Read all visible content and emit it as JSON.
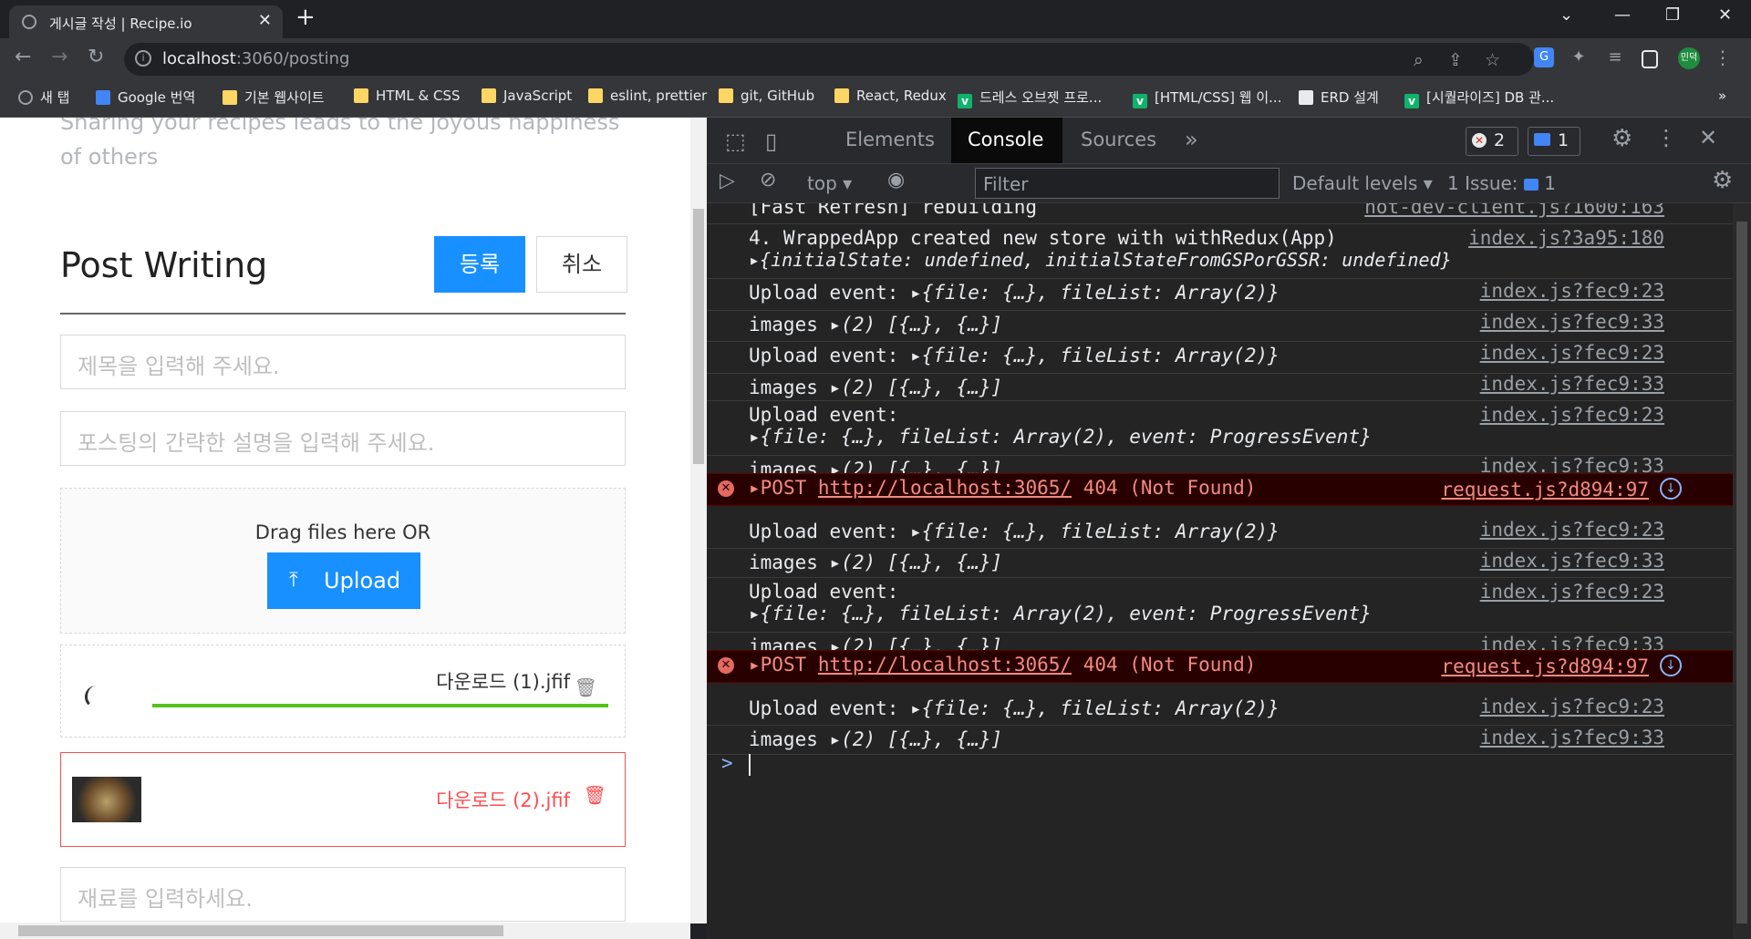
{
  "browser": {
    "tab_title": "게시글 작성 | Recipe.io",
    "new_tab_label": "+",
    "url_host": "localhost",
    "url_path": ":3060/posting",
    "profile_label": "민덕"
  },
  "bookmarks": [
    {
      "label": "새 탭",
      "icon": "globe-icon"
    },
    {
      "label": "Google 번역",
      "icon": "google-translate-icon"
    },
    {
      "label": "기본 웹사이트",
      "icon": "folder-icon"
    },
    {
      "label": "HTML & CSS",
      "icon": "folder-icon"
    },
    {
      "label": "JavaScript",
      "icon": "folder-icon"
    },
    {
      "label": "eslint, prettier",
      "icon": "folder-icon"
    },
    {
      "label": "git, GitHub",
      "icon": "folder-icon"
    },
    {
      "label": "React, Redux",
      "icon": "folder-icon"
    },
    {
      "label": "드레스 오브젯 프로...",
      "icon": "velog-icon"
    },
    {
      "label": "[HTML/CSS] 웹 이...",
      "icon": "velog-icon"
    },
    {
      "label": "ERD 설계",
      "icon": "doc-icon"
    },
    {
      "label": "[시퀄라이즈] DB 관...",
      "icon": "velog-icon"
    }
  ],
  "page": {
    "tagline": "Sharing your recipes leads to the joyous happiness of others",
    "heading": "Post Writing",
    "submit_label": "등록",
    "cancel_label": "취소",
    "title_placeholder": "제목을 입력해 주세요.",
    "desc_placeholder": "포스팅의 간략한 설명을 입력해 주세요.",
    "drag_text": "Drag files here OR",
    "upload_label": "Upload",
    "files": [
      {
        "name": "다운로드 (1).jfif",
        "status": "uploading",
        "progress": 1.0
      },
      {
        "name": "다운로드 (2).jfif",
        "status": "error"
      }
    ],
    "ingredient_placeholder": "재료를 입력하세요."
  },
  "devtools": {
    "tabs": [
      "Elements",
      "Console",
      "Sources"
    ],
    "active_tab": "Console",
    "error_count": "2",
    "message_count": "1",
    "context": "top",
    "filter_placeholder": "Filter",
    "levels": "Default levels",
    "issues_label": "1 Issue:",
    "issues_count": "1"
  },
  "console": {
    "partial_top": {
      "text": "[Fast Refresh] rebuilding",
      "src": "hot-dev-client.js?1600:163"
    },
    "wrapped": {
      "line1": "4. WrappedApp created new store with withRedux(App)",
      "line2": "{initialState: undefined, initialStateFromGSPorGSSR: undefined}",
      "src": "index.js?3a95:180"
    },
    "upload_label": "Upload event:",
    "upload_obj": "{file: {…}, fileList: Array(2)}",
    "upload_obj_progress": "{file: {…}, fileList: Array(2), event: ProgressEvent}",
    "images_label": "images",
    "images_obj": "(2) [{…}, {…}]",
    "src_upload": "index.js?fec9:23",
    "src_images": "index.js?fec9:33",
    "post_method": "POST",
    "post_url": "http://localhost:3065/",
    "post_status": "404 (Not Found)",
    "src_request": "request.js?d894:97",
    "prompt": ">"
  },
  "colors": {
    "primary": "#1890ff",
    "error": "#ff4d4f",
    "progress": "#52c41a",
    "devtools_bg": "#242424"
  }
}
